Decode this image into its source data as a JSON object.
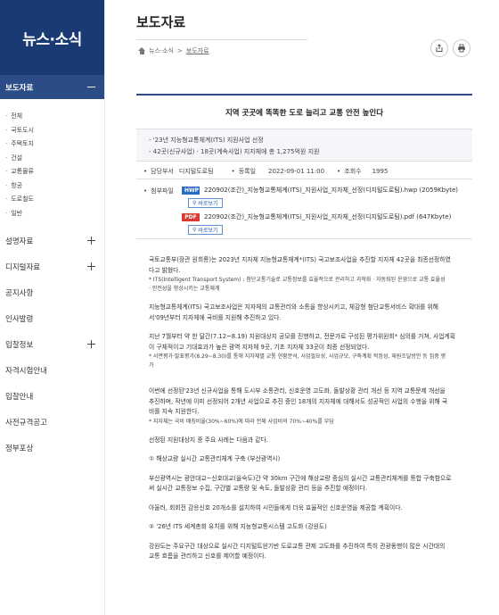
{
  "sidebar": {
    "header": "뉴스·소식",
    "active_section": "보도자료",
    "sub_items": [
      "전체",
      "국토도시",
      "주택토지",
      "건설",
      "교통물류",
      "항공",
      "도로철도",
      "일반"
    ],
    "menu": [
      {
        "label": "설명자료",
        "expandable": true
      },
      {
        "label": "디지털자료",
        "expandable": true
      },
      {
        "label": "공지사항",
        "expandable": false
      },
      {
        "label": "인사발령",
        "expandable": false
      },
      {
        "label": "입찰정보",
        "expandable": true
      },
      {
        "label": "자격시험안내",
        "expandable": false
      },
      {
        "label": "입찰안내",
        "expandable": false
      },
      {
        "label": "사전규격공고",
        "expandable": false
      },
      {
        "label": "정부포상",
        "expandable": false
      }
    ]
  },
  "page": {
    "title": "보도자료",
    "breadcrumb": [
      "뉴스·소식",
      "보도자료"
    ]
  },
  "article": {
    "title": "지역 곳곳에 똑똑한 도로 늘리고 교통 안전 높인다",
    "summary": [
      "- '23년 지능형교통체계(ITS) 지원사업 선정",
      "- 42곳(신규사업) · 18곳(계속사업) 지자체에 총 1,275억원 지원"
    ],
    "meta": {
      "dept_label": "담당부서",
      "dept": "디지털도로팀",
      "date_label": "등록일",
      "date": "2022-09-01 11:00",
      "views_label": "조회수",
      "views": "1995"
    },
    "attachments": {
      "label": "첨부파일",
      "preview_label": "바로보기",
      "files": [
        {
          "type": "HWP",
          "name": "220902(조간)_지능형교통체계(ITS)_지원사업_지자체_선정(디지털도로팀).hwp (2059Kbyte)"
        },
        {
          "type": "PDF",
          "name": "220902(조간)_지능형교통체계(ITS)_지원사업_지자체_선정(디지털도로팀).pdf (647Kbyte)"
        }
      ]
    },
    "body": {
      "p1a": "국토교통부(장관 원희룡)는 2023년 지자체 지능형교통체계*(ITS) 국고보조사업을 추진할 지자체 42곳을 최종선정하였",
      "p1b": "다고 밝혔다.",
      "n1a": "* ITS(Intelligent Transport System) : 첨단교통기술로 교통정보를 효율적으로 관리하고 과학화 · 자동화된 운영으로 교통 효율성",
      "n1b": "· 안전성을 향상시키는 교통체계",
      "p2a": "지능형교통체계(ITS) 국고보조사업은 지자체의 교통관리와 소통을 향상시키고, 체감형 첨단교통서비스 확대를 위해",
      "p2b": "서'09년부터 지자체에 국비를 지원해 추진하고 있다.",
      "p3a": "지난 7월부터 약 한 달간(7.12~8.19) 지원대상지 공모를 진행하고, 전문가로 구성된 평가위원회* 심의를 거쳐, 사업계획",
      "p3b": "이 구체적이고 기대효과가 높은 광역 지자체 9곳, 기초 지자체 33곳이 최종 선정되었다.",
      "n3a": "* 서면평가·발표평가(8.29~8.30)를 통해 지자체별 교통 현황분석, 사업필요성, 사업규모, 구축계획 적정성, 재원조달방안 등 집중 평",
      "n3b": "가",
      "p4a": "이번에 선정된'23년 신규사업을 통해 도시부 소통관리, 신호운영 고도화, 돌발상황 관리 개선 등 지역 교통문제 개선을",
      "p4b": "추진하며, 작년에 이미 선정되어 2개년 사업으로 추진 중인 18개의 지자체에 대해서도 성공적인 사업의 수행을 위해 국",
      "p4c": "비를 지속 지원한다.",
      "n4": "* 지자체는 국비 매칭비율(30%~60%)에 따라 전체 사업비의 70%~40%를 부담",
      "p5": "선정된 지원대상지 중 주요 사례는 다음과 같다.",
      "h1": "① 해상교량 실시간 교통관리체계 구축 (부산광역시)",
      "p6a": "부산광역시는 광안대교~신호대교(을숙도)간 약 30km 구간에 해상교량 중심의 실시간 교통관리체계를 통합 구축함으로",
      "p6b": "써 실시간 교통정보 수집, 구간별 교통량 및 속도, 돌발상황 관리 등을 추진할 예정이다.",
      "p7": "아울러, 회회전 감응신호 20개소를 설치하여 시민들에게 더욱 효율적인 신호운영을 제공할 계획이다.",
      "h2": "② '26년 ITS 세계총회 유치를 위해 지능형교통시스템 고도화 (강원도)",
      "p8a": "강원도는 주요구간 대상으로 실시간 디지털트윈기반 도로교통 관제 고도화를 추진하여 특히 관광동행이 많은 시간대의",
      "p8b": "교통 흐름을 관리하고 신호를 제어할 예정이다."
    }
  }
}
